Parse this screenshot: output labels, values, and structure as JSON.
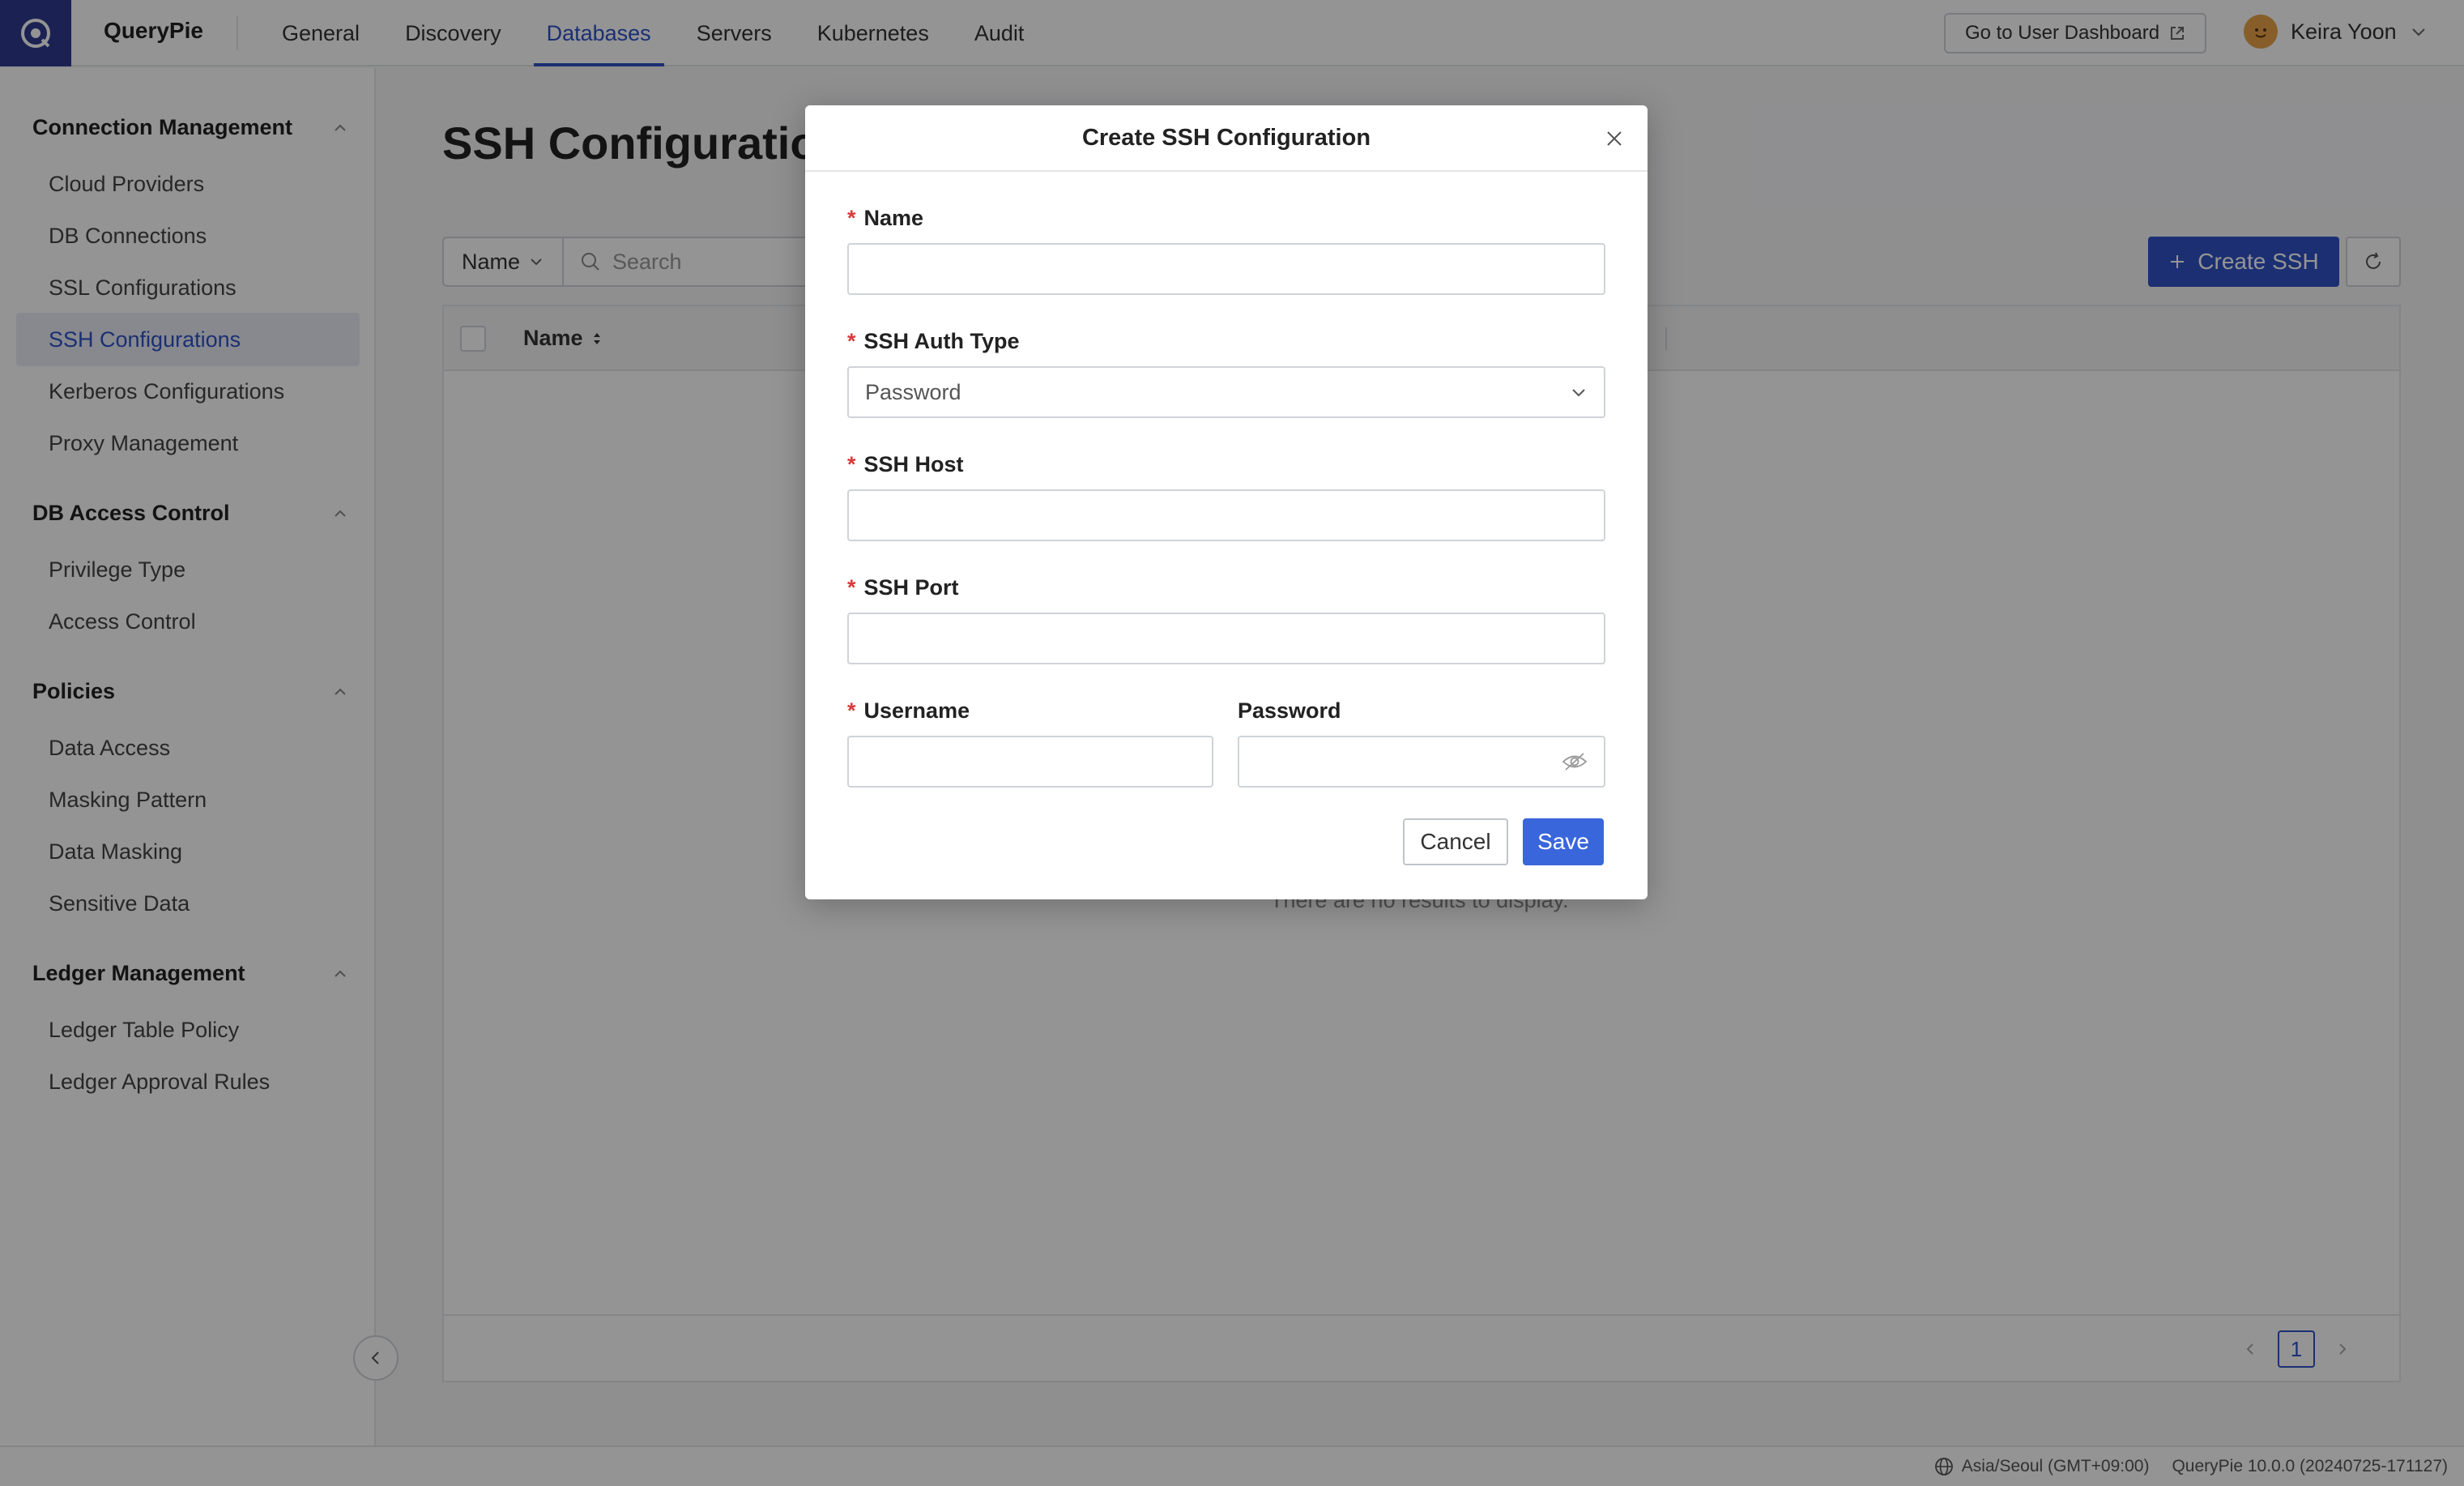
{
  "app": {
    "brand": "QueryPie"
  },
  "nav": {
    "tabs": [
      {
        "label": "General"
      },
      {
        "label": "Discovery"
      },
      {
        "label": "Databases"
      },
      {
        "label": "Servers"
      },
      {
        "label": "Kubernetes"
      },
      {
        "label": "Audit"
      }
    ],
    "active_tab": "Databases"
  },
  "header": {
    "dashboard_label": "Go to User Dashboard",
    "user_name": "Keira Yoon"
  },
  "sidebar": {
    "sections": [
      {
        "title": "Connection Management",
        "items": [
          "Cloud Providers",
          "DB Connections",
          "SSL Configurations",
          "SSH Configurations",
          "Kerberos Configurations",
          "Proxy Management"
        ]
      },
      {
        "title": "DB Access Control",
        "items": [
          "Privilege Type",
          "Access Control"
        ]
      },
      {
        "title": "Policies",
        "items": [
          "Data Access",
          "Masking Pattern",
          "Data Masking",
          "Sensitive Data"
        ]
      },
      {
        "title": "Ledger Management",
        "items": [
          "Ledger Table Policy",
          "Ledger Approval Rules"
        ]
      }
    ],
    "active_item": "SSH Configurations"
  },
  "main": {
    "title": "SSH Configuration",
    "filter_label": "Name",
    "search_placeholder": "Search",
    "create_label": "Create SSH",
    "table_header_name": "Name",
    "empty_text": "There are no results to display.",
    "current_page": "1"
  },
  "footer": {
    "timezone": "Asia/Seoul (GMT+09:00)",
    "version": "QueryPie 10.0.0 (20240725-171127)"
  },
  "modal": {
    "title": "Create SSH Configuration",
    "fields": {
      "name_label": "Name",
      "auth_type_label": "SSH Auth Type",
      "auth_type_value": "Password",
      "host_label": "SSH Host",
      "port_label": "SSH Port",
      "username_label": "Username",
      "password_label": "Password"
    },
    "required_mark": "*",
    "cancel_label": "Cancel",
    "save_label": "Save"
  },
  "colors": {
    "accent": "#2f52c4",
    "required": "#d93a3a",
    "logo_bg": "#2f3b8f"
  }
}
